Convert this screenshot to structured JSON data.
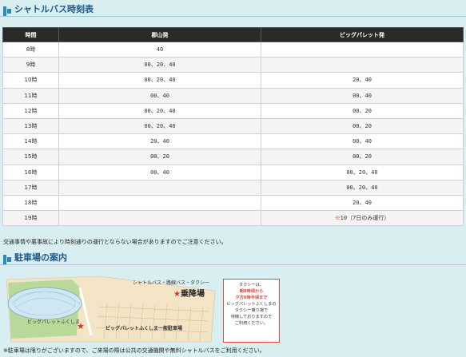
{
  "sections": {
    "timetable_title": "シャトルバス時刻表",
    "parking_title": "駐車場の案内"
  },
  "table": {
    "headers": [
      "時間",
      "郡山発",
      "ビッグパレット発"
    ],
    "rows": [
      {
        "hour": "8時",
        "koriyama": "40",
        "bigpalette": ""
      },
      {
        "hour": "9時",
        "koriyama": "00、20、40",
        "bigpalette": ""
      },
      {
        "hour": "10時",
        "koriyama": "00、20、40",
        "bigpalette": "20、40"
      },
      {
        "hour": "11時",
        "koriyama": "00、40",
        "bigpalette": "00、40"
      },
      {
        "hour": "12時",
        "koriyama": "00、20、40",
        "bigpalette": "00、20"
      },
      {
        "hour": "13時",
        "koriyama": "00、20、40",
        "bigpalette": "00、20"
      },
      {
        "hour": "14時",
        "koriyama": "20、40",
        "bigpalette": "00、40"
      },
      {
        "hour": "15時",
        "koriyama": "00、20",
        "bigpalette": "00、20"
      },
      {
        "hour": "16時",
        "koriyama": "00、40",
        "bigpalette": "00、20、40"
      },
      {
        "hour": "17時",
        "koriyama": "",
        "bigpalette": "00、20、40"
      },
      {
        "hour": "18時",
        "koriyama": "",
        "bigpalette": "20、40"
      },
      {
        "hour": "19時",
        "koriyama": "",
        "bigpalette": "10（7日のみ運行）",
        "bigpalette_mark": "※"
      }
    ]
  },
  "notes": {
    "traffic": "交通事情や悪事故により時刻通りの運行とならない場合がありますのでご注意ください。",
    "parking": "※駐車場は限りがございますので、ご来場の際は公共の交通機関や無料シャトルバスをご利用ください。"
  },
  "map": {
    "bus_types": "シャトルバス・路線バス・タクシー",
    "boarding": "乗降場",
    "venue": "ビッグパレットふくしま",
    "parking": "ビッグパレットふくしま一般駐車場",
    "taxi": {
      "line1": "タクシーは、",
      "line2": "朝8時頃から",
      "line3": "夕方6時半頃まで",
      "line4": "ビッグパレットふくしまの",
      "line5": "タクシー乗り場で",
      "line6": "待機しておりますので",
      "line7": "ご利用ください。"
    }
  },
  "colors": {
    "accent": "#1e5a8c",
    "header_bg": "#2a2a2a",
    "page_bg": "#d9eef0",
    "mark": "#e04a3a"
  }
}
